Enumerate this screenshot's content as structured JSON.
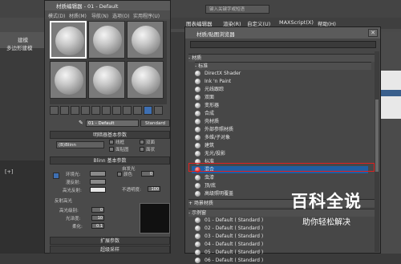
{
  "main_app": {
    "search_placeholder": "键入关键字或短语",
    "menu": [
      "图表编辑器",
      "渲染(R)",
      "自定义(U)",
      "MAXScript(X)",
      "帮助(H)"
    ],
    "left_tabs": [
      "建模",
      "多边形建模"
    ],
    "viewport_label": "[+]"
  },
  "material_editor": {
    "title": "材质编辑器 - 01 - Default",
    "menu": [
      "模式(D)",
      "材质(M)",
      "导航(N)",
      "选项(O)",
      "实用程序(U)"
    ],
    "material_name": "01 - Default",
    "material_type": "Standard",
    "shader_basic": {
      "header": "明暗器基本参数",
      "shader": "(B)Blinn",
      "options": [
        "线框",
        "双面",
        "面贴图",
        "面状"
      ]
    },
    "blinn_basic": {
      "header": "Blinn 基本参数",
      "self_illum_label": "自发光",
      "color_label": "颜色",
      "color_value": "0",
      "ambient": "环境光:",
      "diffuse": "漫反射:",
      "specular": "高光反射:",
      "opacity_label": "不透明度:",
      "opacity_value": "100"
    },
    "specular_highlights": {
      "header": "反射高光",
      "level_label": "高光级别:",
      "level_value": "0",
      "gloss_label": "光泽度:",
      "gloss_value": "10",
      "soften_label": "柔化:",
      "soften_value": "0.1"
    },
    "bottom_rollouts": [
      "扩展参数",
      "超级采样"
    ]
  },
  "browser": {
    "title": "材质/贴图浏览器",
    "sections": {
      "materials": "- 材质",
      "standard": "- 标准",
      "scene": "+ 场景材质",
      "samples": "- 示例窗"
    },
    "standard_items": [
      "DirectX Shader",
      "Ink 'n Paint",
      "光线跟踪",
      "双面",
      "变形器",
      "合成",
      "壳材质",
      "外部参照材质",
      "多维/子对象",
      "建筑",
      "无光/投影",
      "标准",
      "混合",
      "虫漆",
      "顶/底",
      "高级照明覆盖"
    ],
    "selected_item": "混合",
    "sample_items": [
      "01 - Default ( Standard )",
      "02 - Default ( Standard )",
      "03 - Default ( Standard )",
      "04 - Default ( Standard )",
      "05 - Default ( Standard )",
      "06 - Default ( Standard )"
    ]
  },
  "watermark": {
    "title": "百科全说",
    "subtitle": "助你轻松解决"
  },
  "colors": {
    "selection": "#1f5fa3",
    "highlight_outline": "#e02020"
  }
}
